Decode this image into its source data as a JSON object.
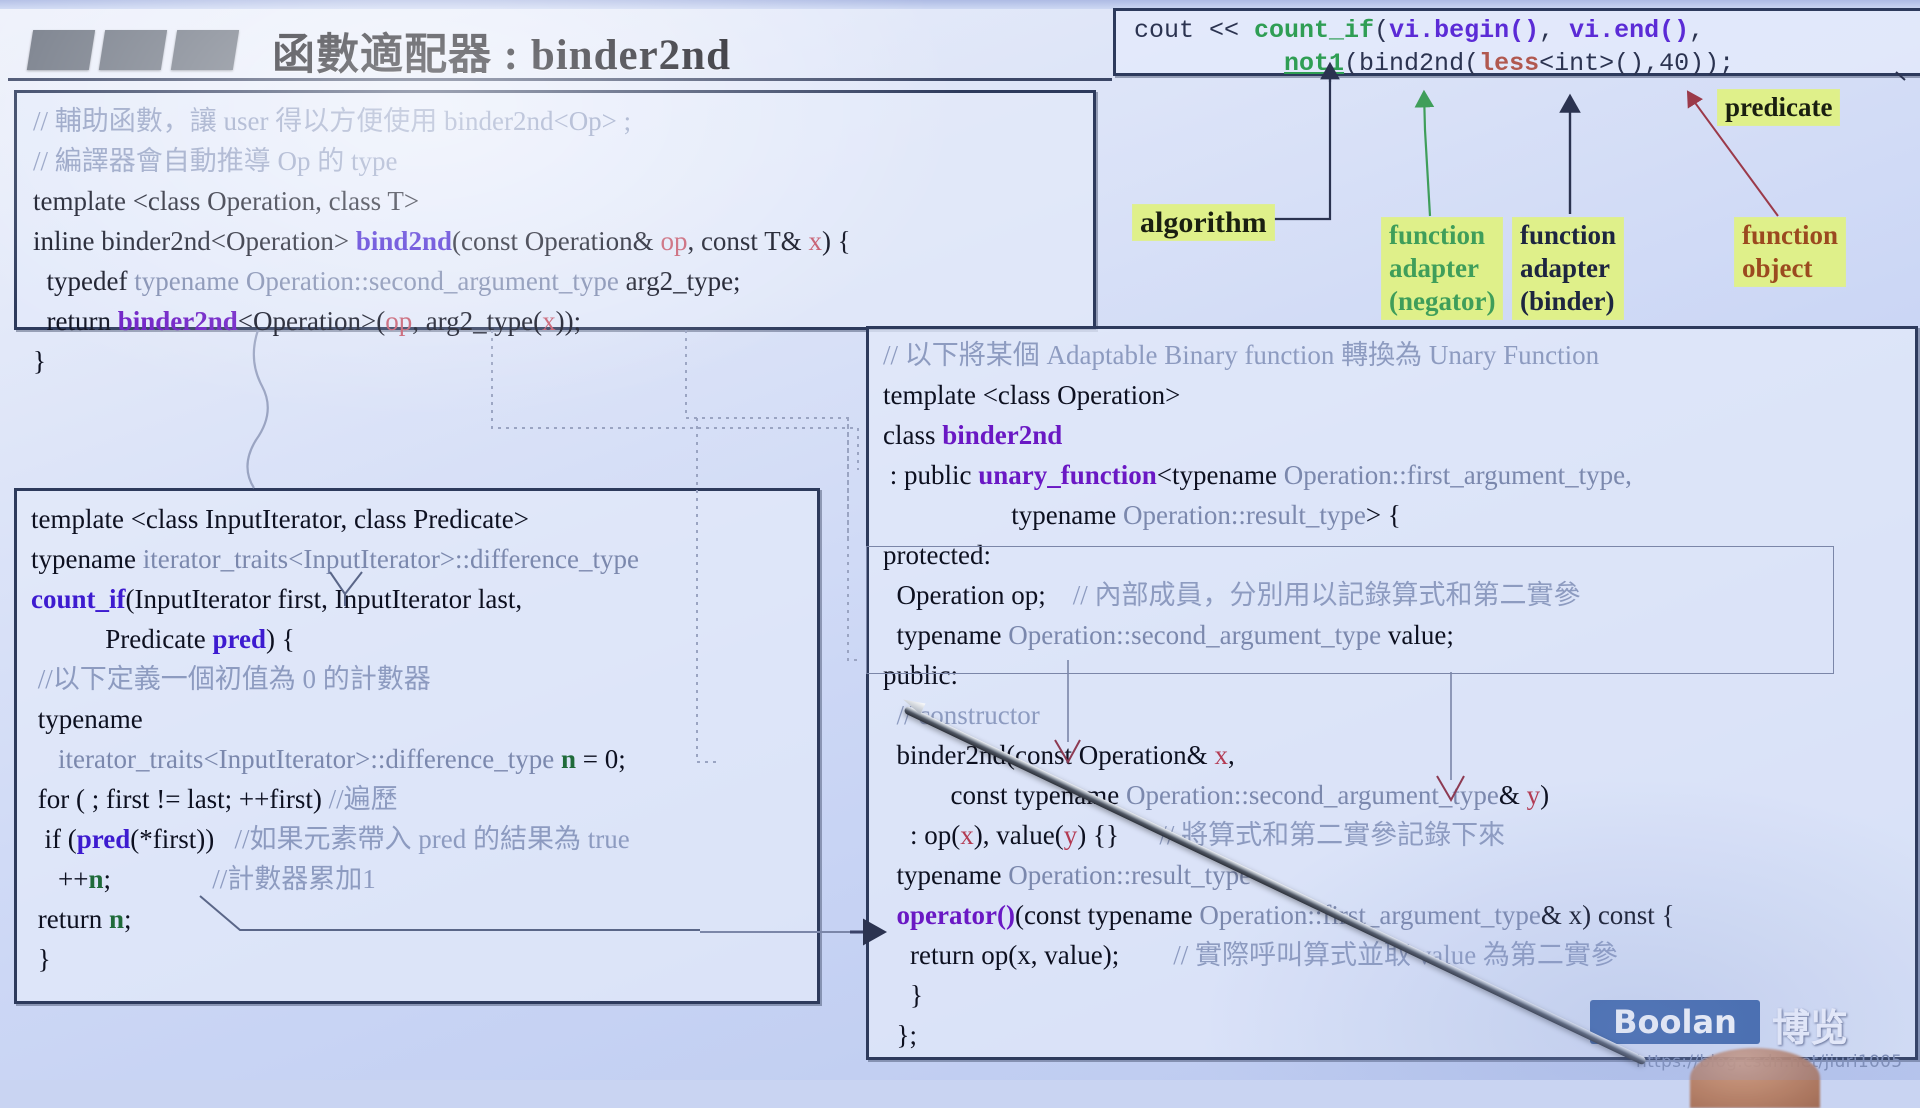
{
  "slide": {
    "title": "函數適配器 : binder2nd",
    "decor_squares": 3
  },
  "box_bind2nd": {
    "lines": [
      {
        "segs": [
          {
            "t": "// 輔助函數，讓 user 得以方便使用 binder2nd<Op> ;",
            "c": "cm"
          }
        ]
      },
      {
        "segs": [
          {
            "t": "// 編譯器會自動推導 Op 的 type",
            "c": "cm"
          }
        ]
      },
      {
        "segs": [
          {
            "t": "template <class Operation, class T>",
            "c": "bk"
          }
        ]
      },
      {
        "segs": [
          {
            "t": "inline binder2nd<Operation> ",
            "c": "bk"
          },
          {
            "t": "bind2nd",
            "c": "kw"
          },
          {
            "t": "(const Operation& ",
            "c": "bk"
          },
          {
            "t": "op",
            "c": "rd"
          },
          {
            "t": ", const T& ",
            "c": "bk"
          },
          {
            "t": "x",
            "c": "rd"
          },
          {
            "t": ") {",
            "c": "bk"
          }
        ]
      },
      {
        "segs": [
          {
            "t": "  typedef ",
            "c": "bk"
          },
          {
            "t": "typename Operation::second_argument_type ",
            "c": "ty"
          },
          {
            "t": "arg2_type;",
            "c": "bk"
          }
        ]
      },
      {
        "segs": [
          {
            "t": "  return ",
            "c": "bk"
          },
          {
            "t": "binder2nd",
            "c": "pv"
          },
          {
            "t": "<Operation>(",
            "c": "bk"
          },
          {
            "t": "op",
            "c": "rd"
          },
          {
            "t": ", arg2_type(",
            "c": "bk"
          },
          {
            "t": "x",
            "c": "rd"
          },
          {
            "t": "));",
            "c": "bk"
          }
        ]
      },
      {
        "segs": [
          {
            "t": "}",
            "c": "bk"
          }
        ]
      }
    ]
  },
  "box_countif": {
    "lines": [
      {
        "segs": [
          {
            "t": "template <class InputIterator, class Predicate>",
            "c": "bk"
          }
        ]
      },
      {
        "segs": [
          {
            "t": "typename ",
            "c": "bk"
          },
          {
            "t": "iterator_traits<InputIterator>::difference_type",
            "c": "ty"
          }
        ]
      },
      {
        "segs": [
          {
            "t": "count_if",
            "c": "kw"
          },
          {
            "t": "(InputIterator first, InputIterator last,",
            "c": "bk"
          }
        ]
      },
      {
        "segs": [
          {
            "t": "           Predicate ",
            "c": "bk"
          },
          {
            "t": "pred",
            "c": "kw"
          },
          {
            "t": ") {",
            "c": "bk"
          }
        ]
      },
      {
        "segs": [
          {
            "t": " //以下定義一個初值為 0 的計數器",
            "c": "cm"
          }
        ]
      },
      {
        "segs": [
          {
            "t": " typename",
            "c": "bk"
          }
        ]
      },
      {
        "segs": [
          {
            "t": "    ",
            "c": "bk"
          },
          {
            "t": "iterator_traits<InputIterator>::difference_type ",
            "c": "ty"
          },
          {
            "t": "n",
            "c": "gn"
          },
          {
            "t": " = 0;",
            "c": "bk"
          }
        ]
      },
      {
        "segs": [
          {
            "t": " for ( ; first != last; ++first) ",
            "c": "bk"
          },
          {
            "t": "//遍歷",
            "c": "cm"
          }
        ]
      },
      {
        "segs": [
          {
            "t": "  if (",
            "c": "bk"
          },
          {
            "t": "pred",
            "c": "kw"
          },
          {
            "t": "(*first))   ",
            "c": "bk"
          },
          {
            "t": "//如果元素帶入 pred 的結果為 true",
            "c": "cm"
          }
        ]
      },
      {
        "segs": [
          {
            "t": "    ++",
            "c": "bk"
          },
          {
            "t": "n",
            "c": "gn"
          },
          {
            "t": ";               ",
            "c": "bk"
          },
          {
            "t": "//計數器累加1",
            "c": "cm"
          }
        ]
      },
      {
        "segs": [
          {
            "t": " return ",
            "c": "bk"
          },
          {
            "t": "n",
            "c": "gn"
          },
          {
            "t": ";",
            "c": "bk"
          }
        ]
      },
      {
        "segs": [
          {
            "t": " }",
            "c": "bk"
          }
        ]
      }
    ]
  },
  "box_call": {
    "lines": [
      {
        "segs": [
          {
            "t": "cout << ",
            "c": "m-def"
          },
          {
            "t": "count_if",
            "c": "m-grn"
          },
          {
            "t": "(",
            "c": "m-def"
          },
          {
            "t": "vi.begin()",
            "c": "m-pur"
          },
          {
            "t": ", ",
            "c": "m-def"
          },
          {
            "t": "vi.end()",
            "c": "m-pur"
          },
          {
            "t": ",",
            "c": "m-def"
          }
        ]
      },
      {
        "segs": [
          {
            "t": "          ",
            "c": "m-def"
          },
          {
            "t": "not1",
            "c": "m-grn m-und"
          },
          {
            "t": "(bind2nd(",
            "c": "m-def"
          },
          {
            "t": "less",
            "c": "m-red"
          },
          {
            "t": "<int>(),40));",
            "c": "m-def"
          }
        ]
      }
    ]
  },
  "box_binder": {
    "lines": [
      {
        "segs": [
          {
            "t": "// 以下將某個 Adaptable Binary function 轉換為 Unary Function",
            "c": "cm"
          }
        ]
      },
      {
        "segs": [
          {
            "t": "template <class Operation>",
            "c": "bk"
          }
        ]
      },
      {
        "segs": [
          {
            "t": "class ",
            "c": "bk"
          },
          {
            "t": "binder2nd",
            "c": "pv"
          }
        ]
      },
      {
        "segs": [
          {
            "t": " : public ",
            "c": "bk"
          },
          {
            "t": "unary_function",
            "c": "pv"
          },
          {
            "t": "<typename ",
            "c": "bk"
          },
          {
            "t": "Operation::first_argument_type,",
            "c": "ty"
          }
        ]
      },
      {
        "segs": [
          {
            "t": "                   typename ",
            "c": "bk"
          },
          {
            "t": "Operation::result_type",
            "c": "ty"
          },
          {
            "t": "> {",
            "c": "bk"
          }
        ]
      },
      {
        "segs": [
          {
            "t": "protected:",
            "c": "bk"
          }
        ]
      },
      {
        "segs": [
          {
            "t": "  Operation ",
            "c": "bk"
          },
          {
            "t": "op",
            "c": "bk"
          },
          {
            "t": ";    ",
            "c": "bk"
          },
          {
            "t": "// 內部成員，分別用以記錄算式和第二實參",
            "c": "cm"
          }
        ]
      },
      {
        "segs": [
          {
            "t": "  typename ",
            "c": "bk"
          },
          {
            "t": "Operation::second_argument_type ",
            "c": "ty"
          },
          {
            "t": "value",
            "c": "bk"
          },
          {
            "t": ";",
            "c": "bk"
          }
        ]
      },
      {
        "segs": [
          {
            "t": "public:",
            "c": "bk"
          }
        ]
      },
      {
        "segs": [
          {
            "t": "  ",
            "c": "bk"
          },
          {
            "t": "// constructor",
            "c": "cm"
          }
        ]
      },
      {
        "segs": [
          {
            "t": "  binder2nd(const Operation& ",
            "c": "bk"
          },
          {
            "t": "x",
            "c": "rd2"
          },
          {
            "t": ",",
            "c": "bk"
          }
        ]
      },
      {
        "segs": [
          {
            "t": "          const typename ",
            "c": "bk"
          },
          {
            "t": "Operation::second_argument_type",
            "c": "ty"
          },
          {
            "t": "& ",
            "c": "bk"
          },
          {
            "t": "y",
            "c": "rd2"
          },
          {
            "t": ")",
            "c": "bk"
          }
        ]
      },
      {
        "segs": [
          {
            "t": "    : ",
            "c": "bk"
          },
          {
            "t": "op",
            "c": "bk"
          },
          {
            "t": "(",
            "c": "bk"
          },
          {
            "t": "x",
            "c": "rd2"
          },
          {
            "t": "), ",
            "c": "bk"
          },
          {
            "t": "value",
            "c": "bk"
          },
          {
            "t": "(",
            "c": "bk"
          },
          {
            "t": "y",
            "c": "rd2"
          },
          {
            "t": ") {}      ",
            "c": "bk"
          },
          {
            "t": "// 將算式和第二實參記錄下來",
            "c": "cm"
          }
        ]
      },
      {
        "segs": [
          {
            "t": "  typename ",
            "c": "bk"
          },
          {
            "t": "Operation::result_type",
            "c": "ty"
          }
        ]
      },
      {
        "segs": [
          {
            "t": "  ",
            "c": "bk"
          },
          {
            "t": "operator()",
            "c": "pv"
          },
          {
            "t": "(const typename ",
            "c": "bk"
          },
          {
            "t": "Operation::first_argument_type",
            "c": "ty"
          },
          {
            "t": "& x) const {",
            "c": "bk"
          }
        ]
      },
      {
        "segs": [
          {
            "t": "    return ",
            "c": "bk"
          },
          {
            "t": "op",
            "c": "bk"
          },
          {
            "t": "(x, ",
            "c": "bk"
          },
          {
            "t": "value",
            "c": "bk"
          },
          {
            "t": ");        ",
            "c": "bk"
          },
          {
            "t": "// 實際呼叫算式並取 value 為第二實參",
            "c": "cm"
          }
        ]
      },
      {
        "segs": [
          {
            "t": "    }",
            "c": "bk"
          }
        ]
      },
      {
        "segs": [
          {
            "t": "  };",
            "c": "bk"
          }
        ]
      }
    ]
  },
  "annotations": {
    "predicate": "predicate",
    "algorithm": "algorithm",
    "function_adapter_negator": "function\nadapter\n(negator)",
    "function_adapter_binder": "function\nadapter\n(binder)",
    "function_object": "function\nobject"
  },
  "branding": {
    "logo_text": "Boolan",
    "logo_cn": "博览",
    "watermark": "https://blog.csdn.net/jiuri1005"
  },
  "colors": {
    "slide_bg": "#c9d4f2",
    "box_border": "#2d3a5c",
    "highlight": "#dff08a",
    "keyword_blue": "#3d1bd0",
    "comment": "#8d9bc0",
    "logo_blue": "#3a63a8",
    "accent_green": "#2f9e54",
    "accent_red": "#b1584f"
  }
}
